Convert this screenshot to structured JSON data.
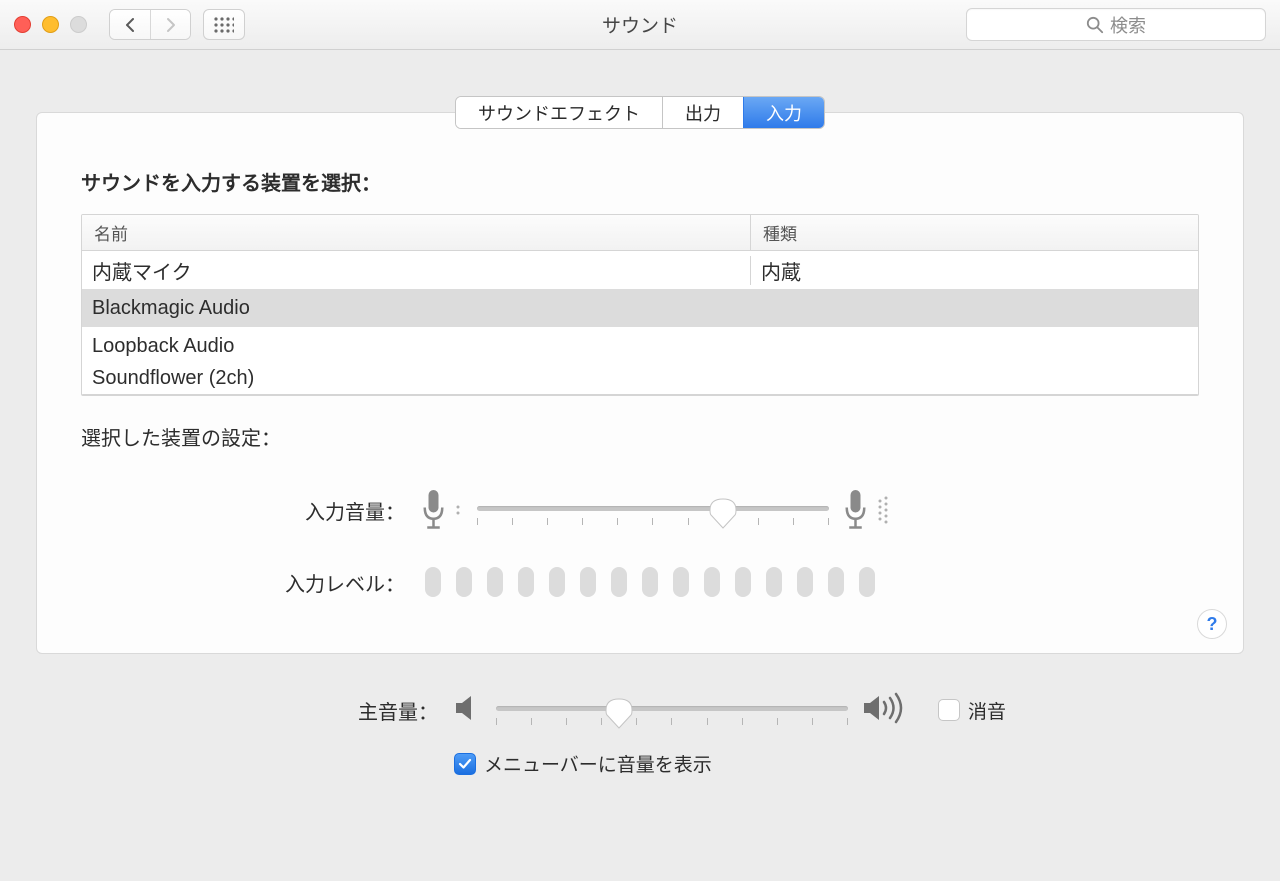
{
  "window": {
    "title": "サウンド",
    "search_placeholder": "検索"
  },
  "tabs": [
    {
      "label": "サウンドエフェクト"
    },
    {
      "label": "出力"
    },
    {
      "label": "入力"
    }
  ],
  "page": {
    "select_device_title": "サウンドを入力する装置を選択：",
    "columns": {
      "name": "名前",
      "kind": "種類"
    },
    "devices": [
      {
        "name": "内蔵マイク",
        "kind": "内蔵",
        "selected": false
      },
      {
        "name": "Blackmagic Audio",
        "kind": "",
        "selected": true
      },
      {
        "name": "Loopback Audio",
        "kind": "",
        "selected": false
      },
      {
        "name": "Soundflower (2ch)",
        "kind": "",
        "selected": false
      }
    ],
    "selected_settings_label": "選択した装置の設定：",
    "input_volume_label": "入力音量：",
    "input_volume_percent": 70,
    "input_level_label": "入力レベル：",
    "output_volume_label": "主音量：",
    "output_volume_percent": 35,
    "mute_label": "消音",
    "mute_checked": false,
    "menubar_label": "メニューバーに音量を表示",
    "menubar_checked": true,
    "help_label": "?"
  }
}
